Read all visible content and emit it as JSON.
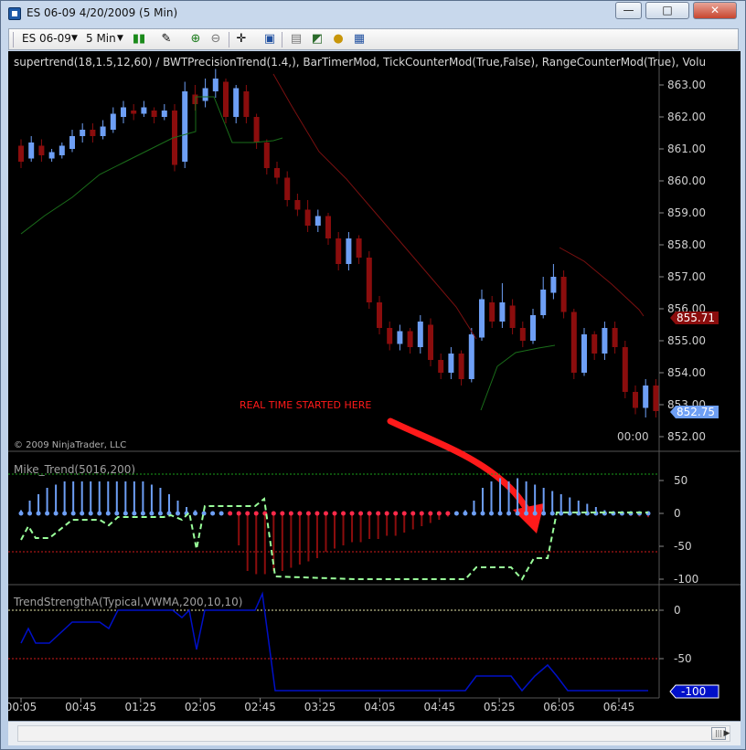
{
  "window": {
    "title": "ES 06-09  4/20/2009 (5 Min)",
    "minimize": "—",
    "maximize": "□",
    "close": "✕"
  },
  "toolbar": {
    "instrument": "ES 06-09",
    "period": "5 Min",
    "icons": [
      "candlestick-icon",
      "pencil-icon",
      "zoom-in-icon",
      "zoom-out-icon",
      "crosshair-icon",
      "properties-icon",
      "folder-icon",
      "strategy-icon",
      "coin-icon",
      "data-box-icon"
    ]
  },
  "price_panel": {
    "indicator_label": "supertrend(18,1.5,12,60)  /  BWTPrecisionTrend(1.4,),  BarTimerMod,  TickCounterMod(True,False),  RangeCounterMod(True),  Volu",
    "copyright": "© 2009 NinjaTrader, LLC",
    "bar_timer": "00:00",
    "annotation": "REAL TIME STARTED HERE",
    "price_ticks": [
      "863.00",
      "862.00",
      "861.00",
      "860.00",
      "859.00",
      "858.00",
      "857.00",
      "856.00",
      "855.00",
      "854.00",
      "853.00",
      "852.00"
    ],
    "marker_high": "855.71",
    "marker_last": "852.75"
  },
  "mike_panel": {
    "label": "Mike_Trend(5016,200)",
    "ticks": [
      "50",
      "0",
      "-50",
      "-100"
    ]
  },
  "trend_panel": {
    "label": "TrendStrengthA(Typical,VWMA,200,10,10)",
    "ticks": [
      "0",
      "-50"
    ],
    "marker": "-100"
  },
  "time_axis": [
    "00:05",
    "00:45",
    "01:25",
    "02:05",
    "02:45",
    "03:25",
    "04:05",
    "04:45",
    "05:25",
    "06:05",
    "06:45"
  ],
  "colors": {
    "up_bar": "#6e9ff5",
    "down_bar": "#8b0d0d",
    "supertrend_up": "#1a6e1a",
    "supertrend_down": "#7a1010",
    "annotation": "#ff1a1a",
    "dashed_line": "#9aff9a",
    "trend_line": "#0010c8"
  }
}
